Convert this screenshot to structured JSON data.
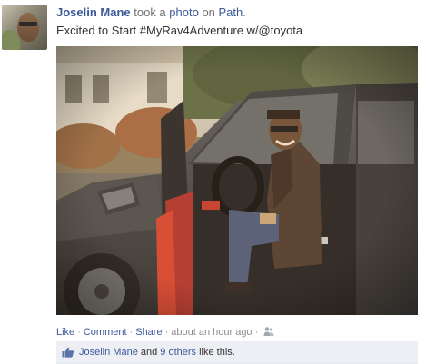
{
  "post": {
    "actor_name": "Joselin Mane",
    "verb_text": " took a ",
    "object_link": "photo",
    "on_text": " on ",
    "app_link": "Path",
    "period": ".",
    "message": "Excited to Start #MyRav4Adventure w/@toyota"
  },
  "avatar": {
    "icon": "profile-photo"
  },
  "photo": {
    "subject": "man-sitting-in-car-driver-seat"
  },
  "actions": {
    "like": "Like",
    "sep1": "·",
    "comment": "Comment",
    "sep2": "·",
    "share": "Share",
    "sep3": "·",
    "time": "about an hour ago",
    "sep4": "·",
    "audience_icon": "friends-icon"
  },
  "likes": {
    "icon": "thumbs-up-icon",
    "first_name": "Joselin Mane",
    "and_text": " and ",
    "others_link": "9 others",
    "suffix": " like this."
  },
  "colors": {
    "link": "#3b5998",
    "muted": "#8c8c8c",
    "likes_bg": "#edeff4"
  }
}
